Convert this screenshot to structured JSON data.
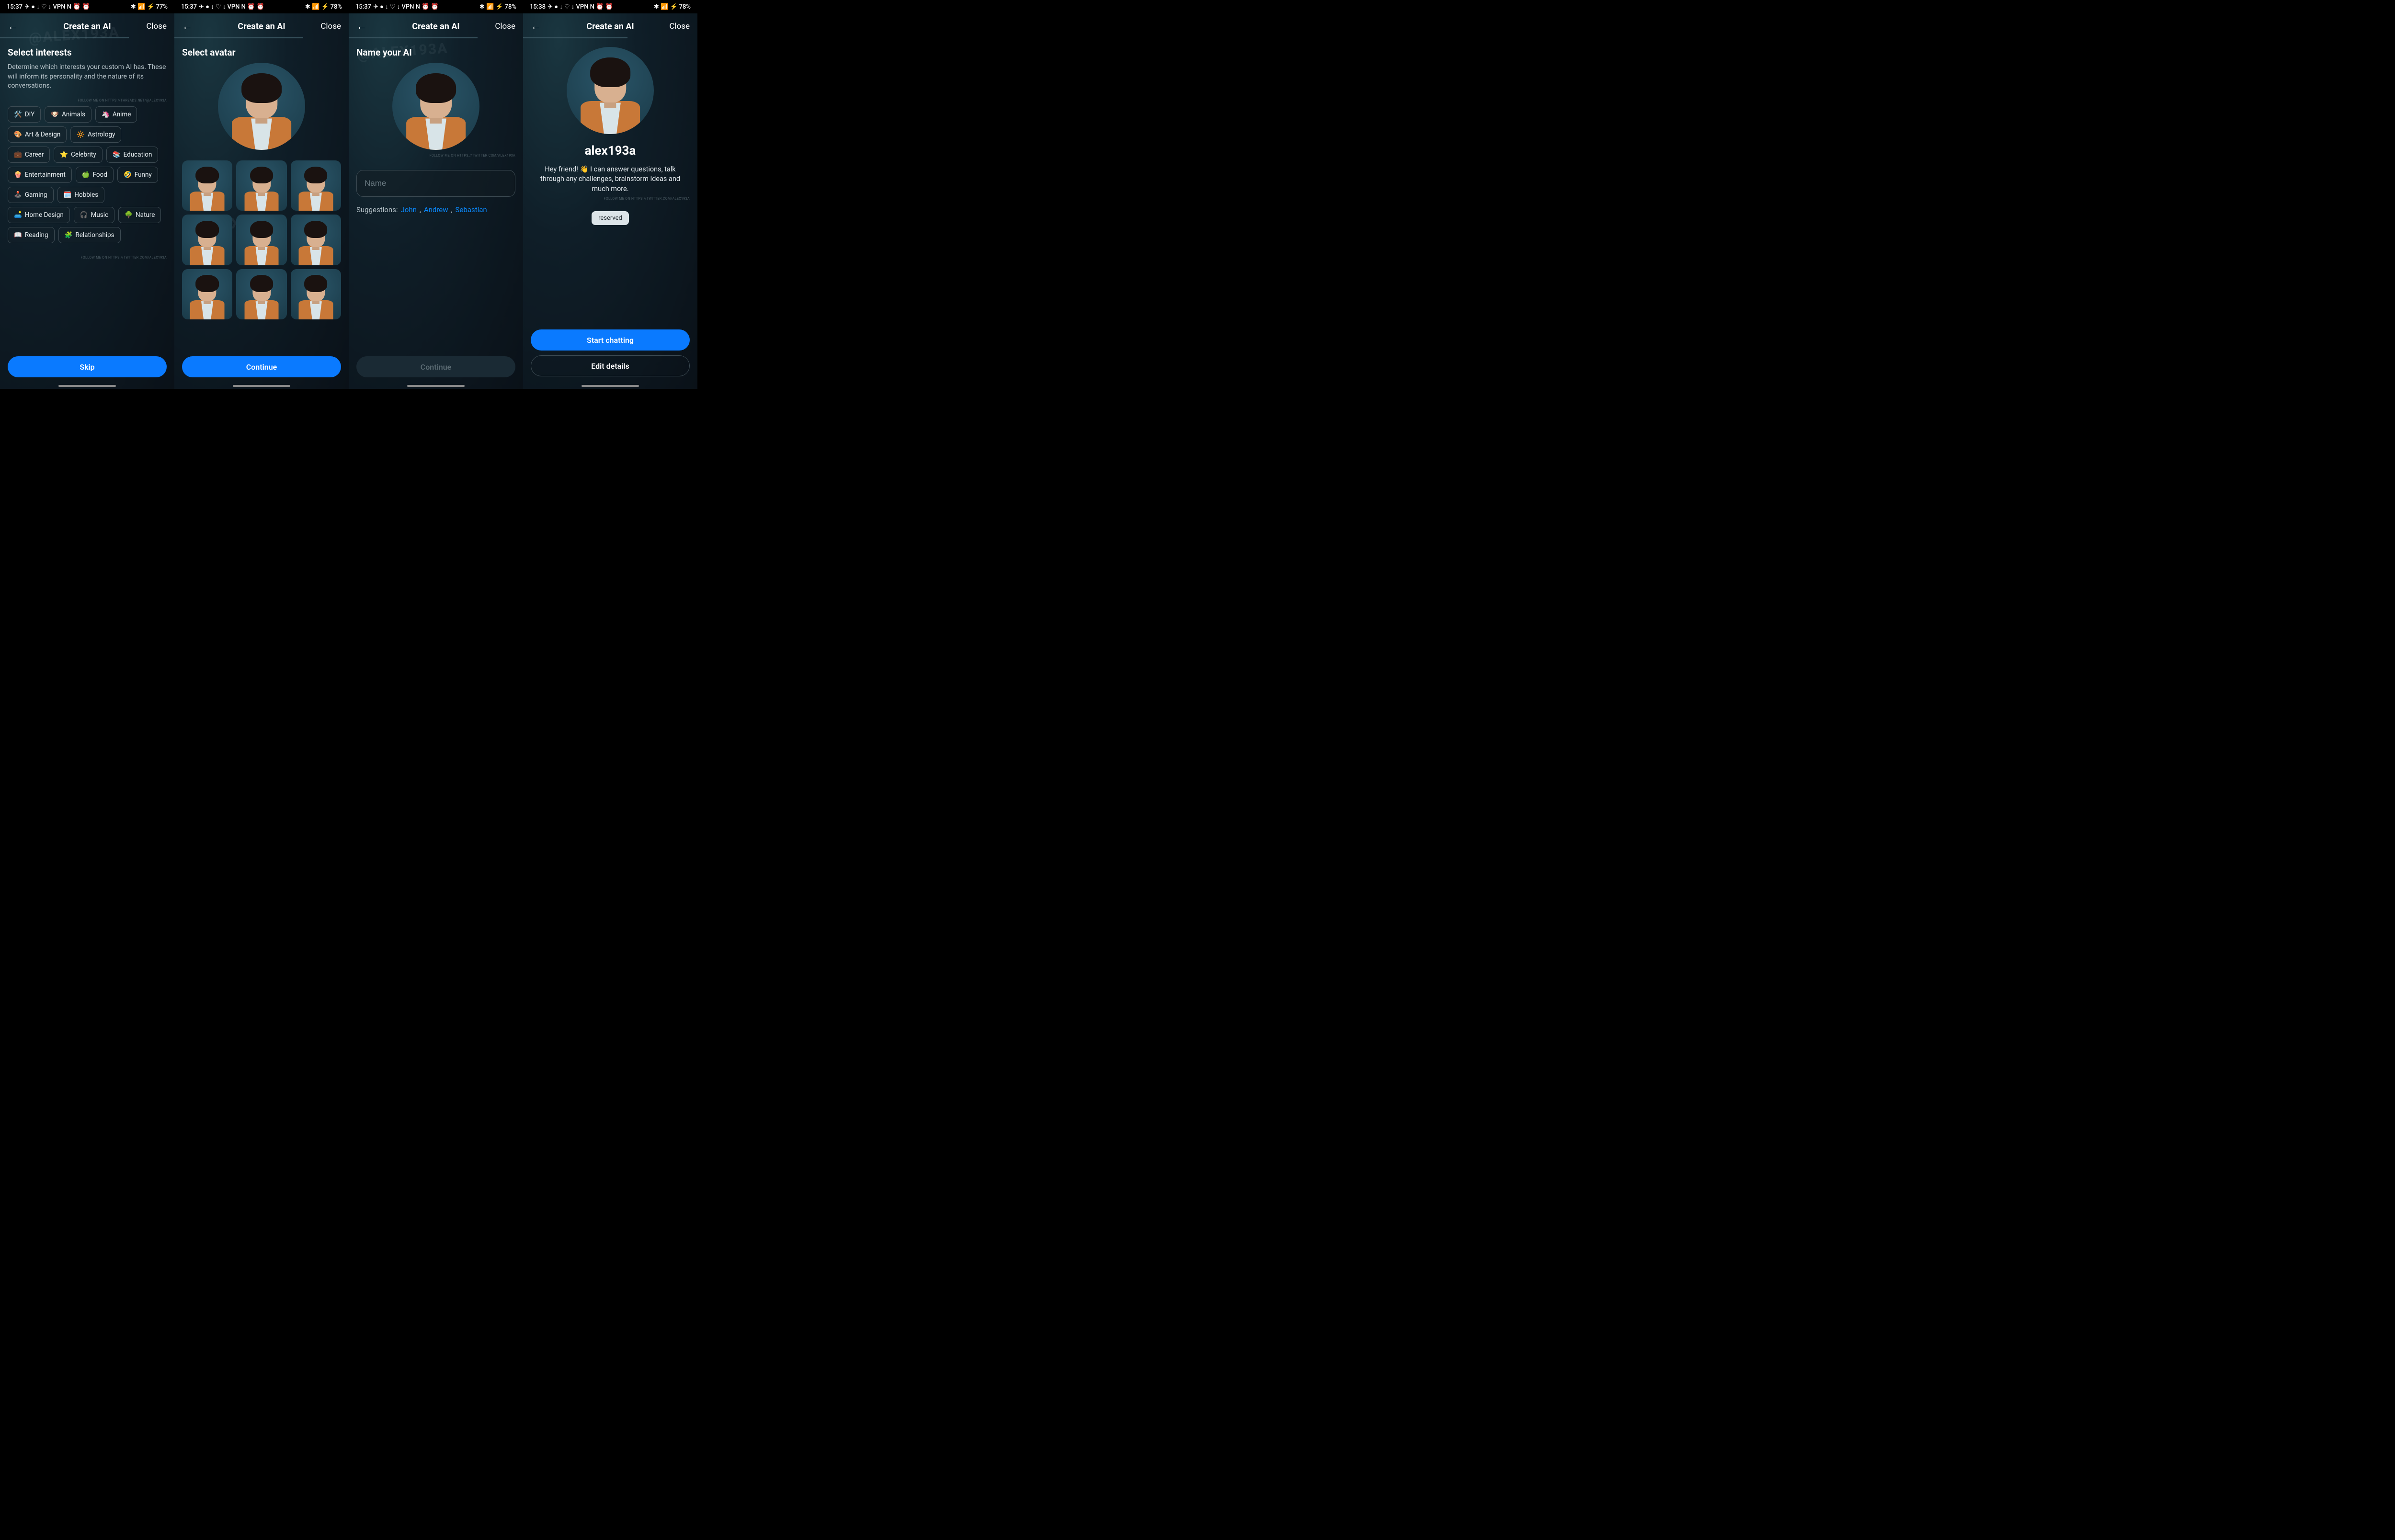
{
  "status": {
    "time_a": "15:37",
    "time_b": "15:37",
    "time_c": "15:37",
    "time_d": "15:38",
    "battery_a": "77%",
    "battery_b": "78%",
    "battery_c": "78%",
    "battery_d": "78%"
  },
  "header": {
    "title": "Create an AI",
    "close": "Close"
  },
  "watermarks": {
    "threads": "FOLLOW ME ON HTTPS://THREADS.NET/@ALEX193A",
    "twitter": "FOLLOW ME ON HTTPS://TWITTER.COM/ALEX193A",
    "handle": "@ALEX193A"
  },
  "screen1": {
    "title": "Select interests",
    "desc": "Determine which interests your custom AI has. These will inform its personality and the nature of its conversations.",
    "chips": [
      {
        "emoji": "🛠️",
        "label": "DIY"
      },
      {
        "emoji": "🐶",
        "label": "Animals"
      },
      {
        "emoji": "🦄",
        "label": "Anime"
      },
      {
        "emoji": "🎨",
        "label": "Art & Design"
      },
      {
        "emoji": "🔆",
        "label": "Astrology"
      },
      {
        "emoji": "💼",
        "label": "Career"
      },
      {
        "emoji": "⭐",
        "label": "Celebrity"
      },
      {
        "emoji": "📚",
        "label": "Education"
      },
      {
        "emoji": "🍿",
        "label": "Entertainment"
      },
      {
        "emoji": "🍏",
        "label": "Food"
      },
      {
        "emoji": "🤣",
        "label": "Funny"
      },
      {
        "emoji": "🕹️",
        "label": "Gaming"
      },
      {
        "emoji": "🗓️",
        "label": "Hobbies"
      },
      {
        "emoji": "🛋️",
        "label": "Home Design"
      },
      {
        "emoji": "🎧",
        "label": "Music"
      },
      {
        "emoji": "🌳",
        "label": "Nature"
      },
      {
        "emoji": "📖",
        "label": "Reading"
      },
      {
        "emoji": "🧩",
        "label": "Relationships"
      }
    ],
    "skip": "Skip"
  },
  "screen2": {
    "title": "Select avatar",
    "continue": "Continue"
  },
  "screen3": {
    "title": "Name your AI",
    "placeholder": "Name",
    "suggestions_label": "Suggestions:",
    "suggestions": [
      "John",
      "Andrew",
      "Sebastian"
    ],
    "continue": "Continue"
  },
  "screen4": {
    "ai_name": "alex193a",
    "desc": "Hey friend! 👋 I can answer questions, talk through any challenges, brainstorm ideas and much more.",
    "reserved": "reserved",
    "start": "Start chatting",
    "edit": "Edit details"
  }
}
